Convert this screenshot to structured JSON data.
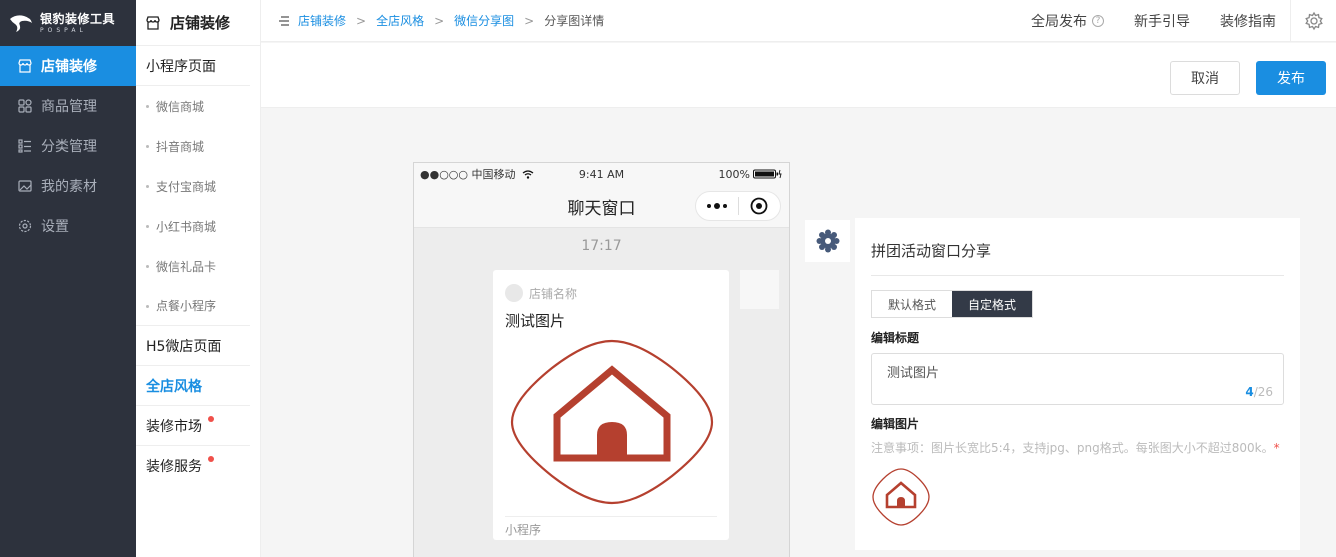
{
  "brand": {
    "title": "银豹装修工具",
    "subtitle": "POSPAL"
  },
  "nav": {
    "items": [
      {
        "label": "店铺装修",
        "icon": "shop-icon"
      },
      {
        "label": "商品管理",
        "icon": "grid-icon"
      },
      {
        "label": "分类管理",
        "icon": "list-icon"
      },
      {
        "label": "我的素材",
        "icon": "image-icon"
      },
      {
        "label": "设置",
        "icon": "gear-icon"
      }
    ]
  },
  "subnav": {
    "title": "店铺装修",
    "mini_program": "小程序页面",
    "mini_items": [
      "微信商城",
      "抖音商城",
      "支付宝商城",
      "小红书商城",
      "微信礼品卡",
      "点餐小程序"
    ],
    "h5": "H5微店页面",
    "store_style": "全店风格",
    "market": "装修市场",
    "service": "装修服务"
  },
  "breadcrumb": [
    "店铺装修",
    "全店风格",
    "微信分享图",
    "分享图详情"
  ],
  "topbar": {
    "publish_all": "全局发布",
    "guide": "新手引导",
    "manual": "装修指南"
  },
  "actions": {
    "cancel": "取消",
    "publish": "发布"
  },
  "phone": {
    "carrier": "●●○○○ 中国移动",
    "time": "9:41 AM",
    "battery": "100%",
    "chat_title": "聊天窗口",
    "chat_time": "17:17",
    "shop_name": "店铺名称",
    "card_title": "测试图片",
    "card_footer": "小程序"
  },
  "panel": {
    "title": "拼团活动窗口分享",
    "tabs": [
      "默认格式",
      "自定格式"
    ],
    "active_tab": 1,
    "title_label": "编辑标题",
    "title_value": "测试图片",
    "count_current": "4",
    "count_max": "/26",
    "image_label": "编辑图片",
    "hint": "注意事项：图片长宽比5:4，支持jpg、png格式。每张图大小不超过800k。",
    "hint_required": "*"
  },
  "colors": {
    "primary": "#1a8ee1",
    "sidebar": "#2d323d",
    "accent_red": "#b5402f"
  }
}
